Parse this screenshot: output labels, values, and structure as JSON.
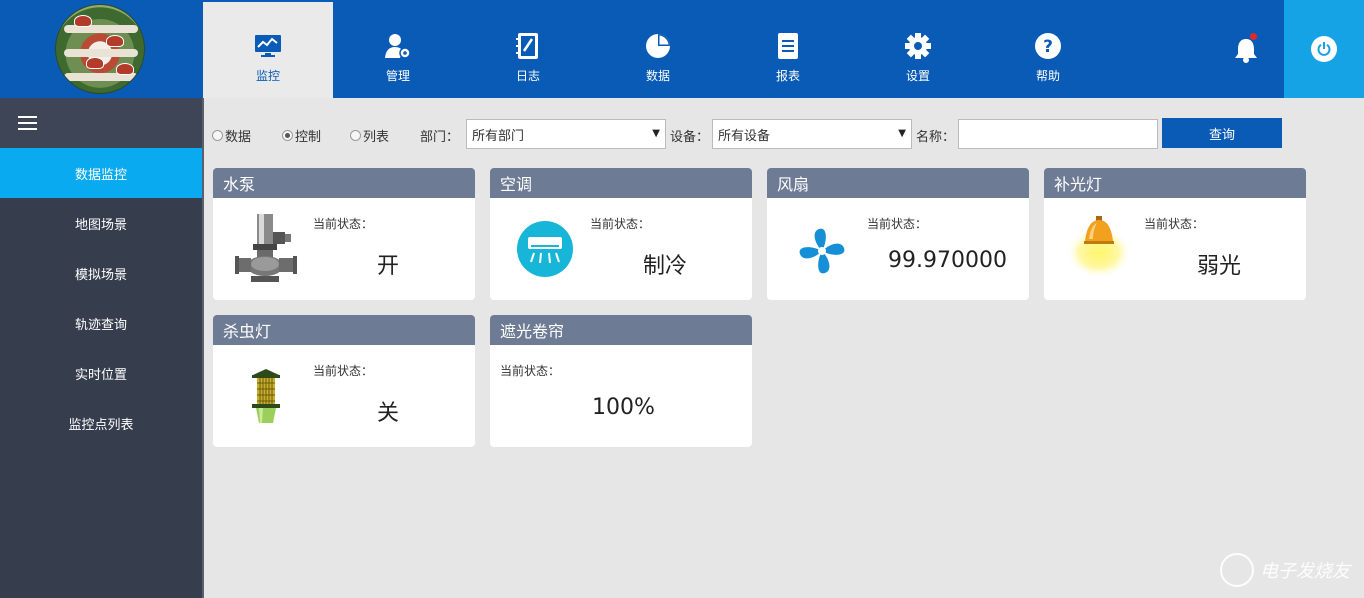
{
  "nav": {
    "items": [
      {
        "label": "监控",
        "icon": "monitor-icon"
      },
      {
        "label": "管理",
        "icon": "user-settings-icon"
      },
      {
        "label": "日志",
        "icon": "notebook-icon"
      },
      {
        "label": "数据",
        "icon": "pie-chart-icon"
      },
      {
        "label": "报表",
        "icon": "report-icon"
      },
      {
        "label": "设置",
        "icon": "gear-icon"
      },
      {
        "label": "帮助",
        "icon": "help-icon"
      }
    ],
    "active_index": 0
  },
  "sidebar": {
    "items": [
      {
        "label": "数据监控"
      },
      {
        "label": "地图场景"
      },
      {
        "label": "模拟场景"
      },
      {
        "label": "轨迹查询"
      },
      {
        "label": "实时位置"
      },
      {
        "label": "监控点列表"
      }
    ],
    "active_index": 0
  },
  "toolbar": {
    "radios": [
      {
        "label": "数据",
        "checked": false
      },
      {
        "label": "控制",
        "checked": true
      },
      {
        "label": "列表",
        "checked": false
      }
    ],
    "department_label": "部门：",
    "department_value": "所有部门",
    "device_label": "设备：",
    "device_value": "所有设备",
    "name_label": "名称：",
    "name_value": "",
    "query_label": "查询"
  },
  "cards": [
    {
      "title": "水泵",
      "status_label": "当前状态：",
      "status_value": "开",
      "icon": "water-pump-icon"
    },
    {
      "title": "空调",
      "status_label": "当前状态：",
      "status_value": "制冷",
      "icon": "air-conditioner-icon"
    },
    {
      "title": "风扇",
      "status_label": "当前状态：",
      "status_value": "99.970000",
      "icon": "fan-icon"
    },
    {
      "title": "补光灯",
      "status_label": "当前状态：",
      "status_value": "弱光",
      "icon": "grow-light-icon"
    },
    {
      "title": "杀虫灯",
      "status_label": "当前状态：",
      "status_value": "关",
      "icon": "insect-lamp-icon"
    },
    {
      "title": "遮光卷帘",
      "status_label": "当前状态：",
      "status_value": "100%",
      "icon": ""
    }
  ],
  "colors": {
    "topbar": "#0a5bb5",
    "sidebar": "#363e4e",
    "sidebar_active": "#0aaaf0",
    "card_header": "#6e7b94",
    "power_button": "#16a3e6"
  },
  "watermark": "电子发烧友"
}
